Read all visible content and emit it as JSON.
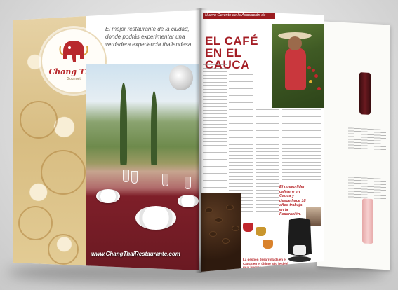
{
  "left_page": {
    "tagline": "El mejor restaurante de la ciudad, donde podrás experimentar una verdadera experiencia thailandesa",
    "logo": {
      "name": "Chang Thai",
      "sub": "Gourmet"
    },
    "website": "www.ChangThaiRestaurante.com"
  },
  "right_page": {
    "kicker": "Nuevo Gerente de la Asociación de cafeteros",
    "title": "EL CAFÉ EN EL CAUCA",
    "quote": "El nuevo líder cafetero en Cauca y desde hace 18 años trabaja en la Federación.",
    "caption": "La gestión desarrollada en el Cauca en el último año le dejó muy buenos resultados."
  }
}
